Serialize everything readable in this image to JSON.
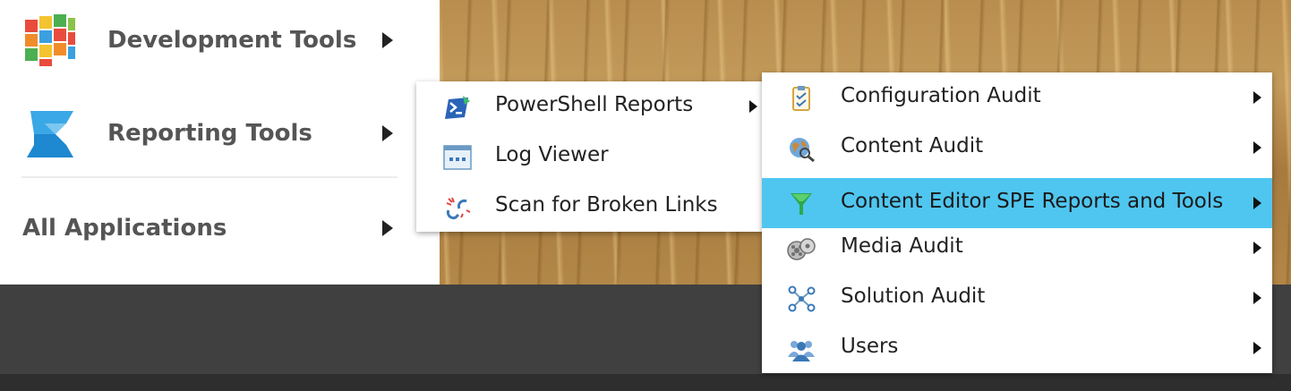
{
  "main_menu": {
    "items": [
      {
        "label": "Development Tools",
        "icon": "development-tools-cube-icon"
      },
      {
        "label": "Reporting Tools",
        "icon": "reporting-tools-icon"
      },
      {
        "label": "All Applications"
      }
    ]
  },
  "reporting_submenu": {
    "items": [
      {
        "label": "PowerShell Reports",
        "icon": "powershell-icon",
        "has_submenu": true
      },
      {
        "label": "Log Viewer",
        "icon": "log-viewer-icon",
        "has_submenu": false
      },
      {
        "label": "Scan for Broken Links",
        "icon": "broken-link-icon",
        "has_submenu": false
      }
    ]
  },
  "powershell_submenu": {
    "items": [
      {
        "label": "Configuration Audit",
        "icon": "clipboard-check-icon"
      },
      {
        "label": "Content Audit",
        "icon": "globe-search-icon"
      },
      {
        "label": "Content Editor SPE Reports and Tools",
        "icon": "funnel-icon",
        "highlighted": true
      },
      {
        "label": "Media Audit",
        "icon": "film-reels-icon"
      },
      {
        "label": "Solution Audit",
        "icon": "network-nodes-icon"
      },
      {
        "label": "Users",
        "icon": "users-group-icon"
      }
    ]
  },
  "colors": {
    "highlight": "#4fc6f0",
    "menu_background": "#ffffff",
    "taskbar": "#404040"
  }
}
